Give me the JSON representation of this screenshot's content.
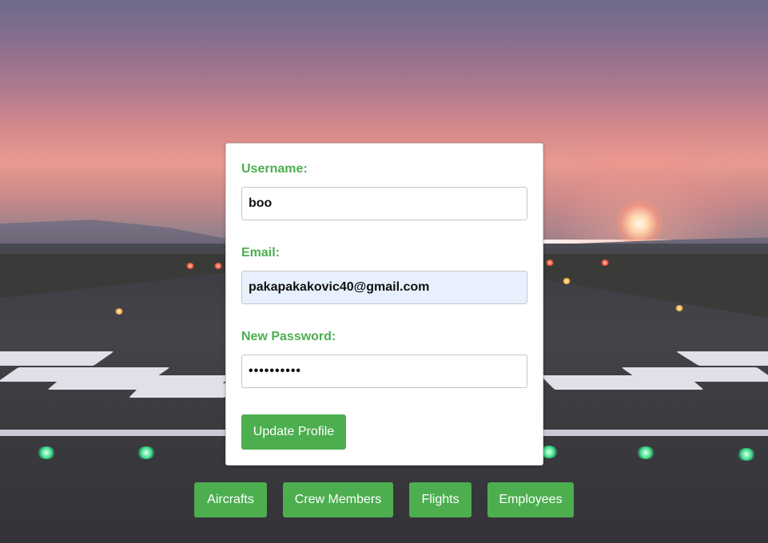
{
  "form": {
    "username_label": "Username:",
    "username_value": "boo",
    "email_label": "Email:",
    "email_value": "pakapakakovic40@gmail.com",
    "password_label": "New Password:",
    "password_value": "••••••••••",
    "submit_label": "Update Profile"
  },
  "nav": {
    "items": [
      {
        "label": "Aircrafts"
      },
      {
        "label": "Crew Members"
      },
      {
        "label": "Flights"
      },
      {
        "label": "Employees"
      }
    ]
  },
  "colors": {
    "accent": "#4cae4f",
    "autofill_bg": "#e8f0fe",
    "card_bg": "#ffffff"
  },
  "background": {
    "scene": "runway-at-sunset"
  }
}
